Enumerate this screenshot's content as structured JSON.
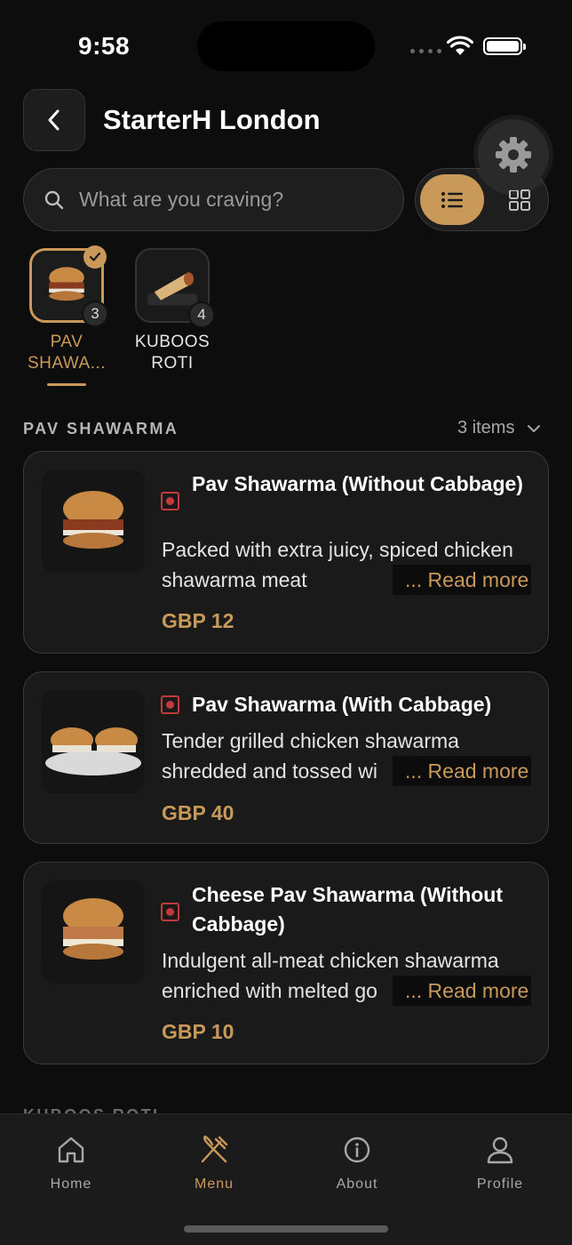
{
  "status_bar": {
    "time": "9:58"
  },
  "header": {
    "title": "StarterH London"
  },
  "search": {
    "placeholder": "What are you craving?"
  },
  "categories": [
    {
      "label": "PAV SHAWA...",
      "count": "3",
      "active": true
    },
    {
      "label": "KUBOOS ROTI",
      "count": "4",
      "active": false
    }
  ],
  "section": {
    "title": "PAV SHAWARMA",
    "count": "3 items"
  },
  "items": [
    {
      "name": "Pav Shawarma (Without Cabbage)",
      "description": "Packed with extra juicy, spiced chicken shawarma meat",
      "read_more": "... Read more",
      "price": "GBP 12"
    },
    {
      "name": "Pav Shawarma (With Cabbage)",
      "description": "Tender grilled chicken shawarma shredded and tossed wi",
      "read_more": "... Read more",
      "price": "GBP 40"
    },
    {
      "name": "Cheese Pav Shawarma (Without Cabbage)",
      "description": "Indulgent all-meat chicken shawarma enriched with melted go",
      "read_more": "... Read more",
      "price": "GBP 10"
    }
  ],
  "next_section": {
    "title": "KUBOOS ROTI"
  },
  "nav": {
    "home": "Home",
    "menu": "Menu",
    "about": "About",
    "profile": "Profile",
    "active": "menu"
  },
  "colors": {
    "accent": "#c9995a",
    "background": "#0d0d0d",
    "card": "#1a1a1a",
    "veg_mark": "#c43a3a"
  }
}
